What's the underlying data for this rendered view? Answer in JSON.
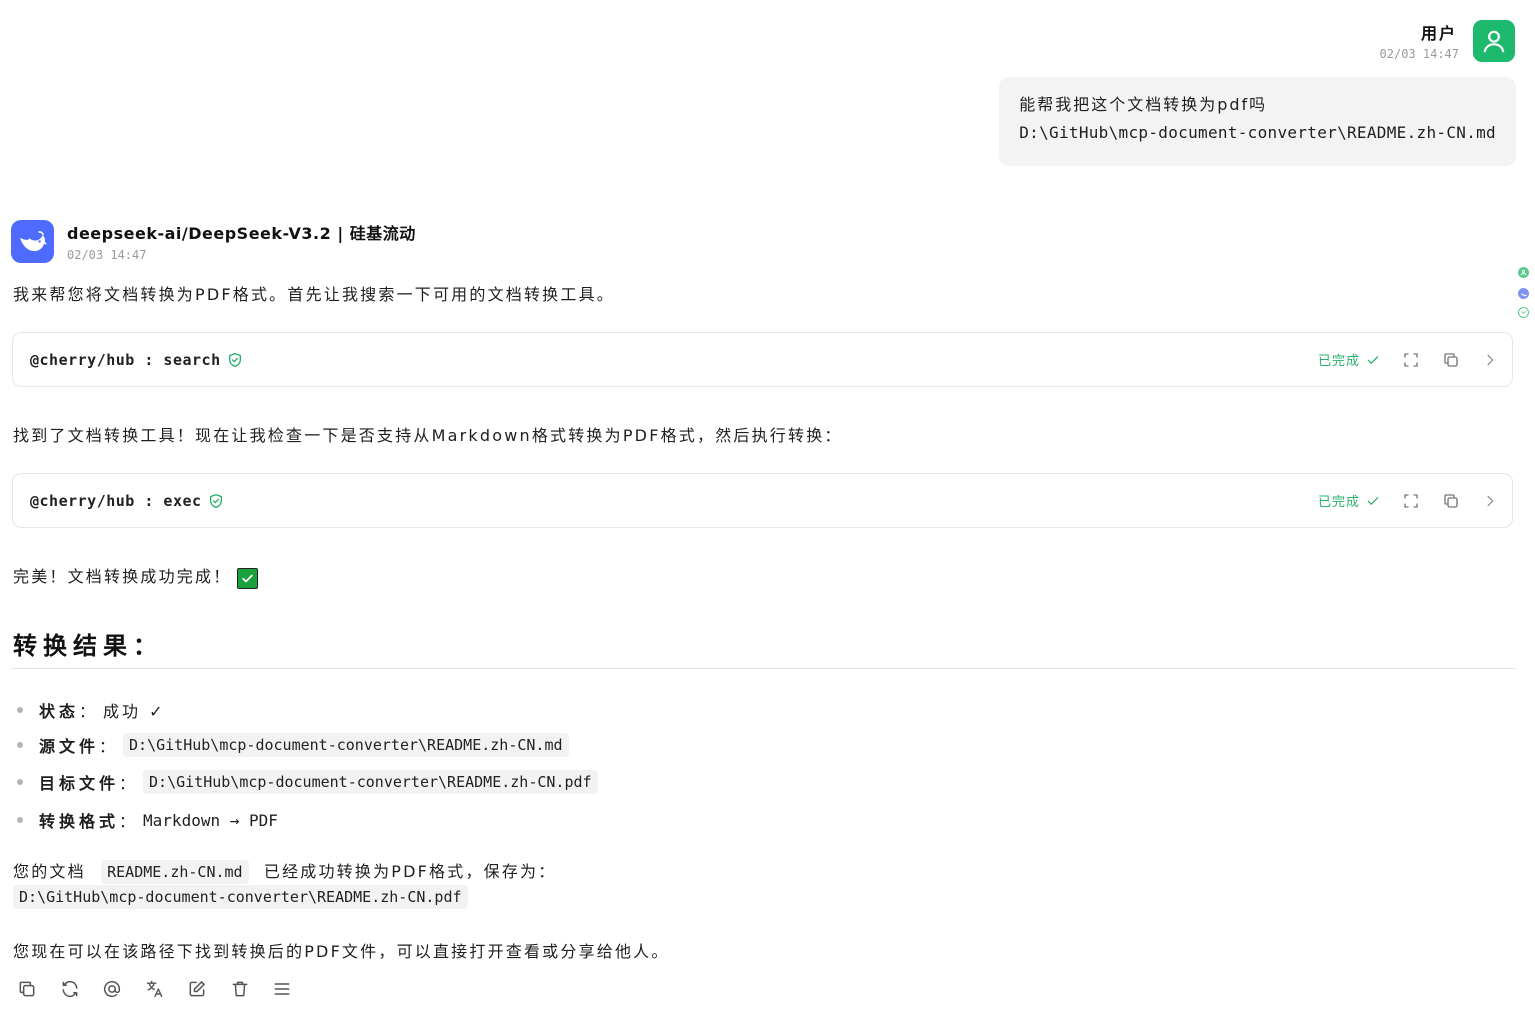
{
  "user": {
    "name": "用户",
    "time": "02/03 14:47",
    "message_line1": "能帮我把这个文档转换为pdf吗",
    "message_line2": "D:\\GitHub\\mcp-document-converter\\README.zh-CN.md",
    "avatar_color": "#1dba6d",
    "avatar_icon": "user-icon"
  },
  "assistant": {
    "model_name": "deepseek-ai/DeepSeek-V3.2 | 硅基流动",
    "time": "02/03 14:47",
    "avatar_color": "#4d6bfe",
    "avatar_icon": "deepseek-whale-icon",
    "intro": "我来帮您将文档转换为PDF格式。首先让我搜索一下可用的文档转换工具。",
    "tool_calls": [
      {
        "name": "@cherry/hub : search",
        "status": "已完成"
      },
      {
        "name": "@cherry/hub : exec",
        "status": "已完成"
      }
    ],
    "found_text": "找到了文档转换工具！现在让我检查一下是否支持从Markdown格式转换为PDF格式，然后执行转换：",
    "done_text": "完美！文档转换成功完成！",
    "result_heading": "转换结果：",
    "results": [
      {
        "key": "状态",
        "value": "成功 ✓",
        "is_code": false
      },
      {
        "key": "源文件",
        "value": "D:\\GitHub\\mcp-document-converter\\README.zh-CN.md",
        "is_code": true
      },
      {
        "key": "目标文件",
        "value": "D:\\GitHub\\mcp-document-converter\\README.zh-CN.pdf",
        "is_code": true
      },
      {
        "key": "转换格式",
        "value": "Markdown → PDF",
        "is_code": false
      }
    ],
    "summary_prefix": "您的文档",
    "summary_file": "README.zh-CN.md",
    "summary_suffix": "已经成功转换为PDF格式，保存为：",
    "summary_path": "D:\\GitHub\\mcp-document-converter\\README.zh-CN.pdf",
    "closing": "您现在可以在该路径下找到转换后的PDF文件，可以直接打开查看或分享给他人。"
  },
  "toolbar_icons": [
    "copy-icon",
    "regenerate-icon",
    "mention-icon",
    "translate-icon",
    "edit-icon",
    "delete-icon",
    "menu-icon"
  ],
  "colors": {
    "success": "#27b06a",
    "accent": "#4d6bfe",
    "user": "#1dba6d"
  }
}
